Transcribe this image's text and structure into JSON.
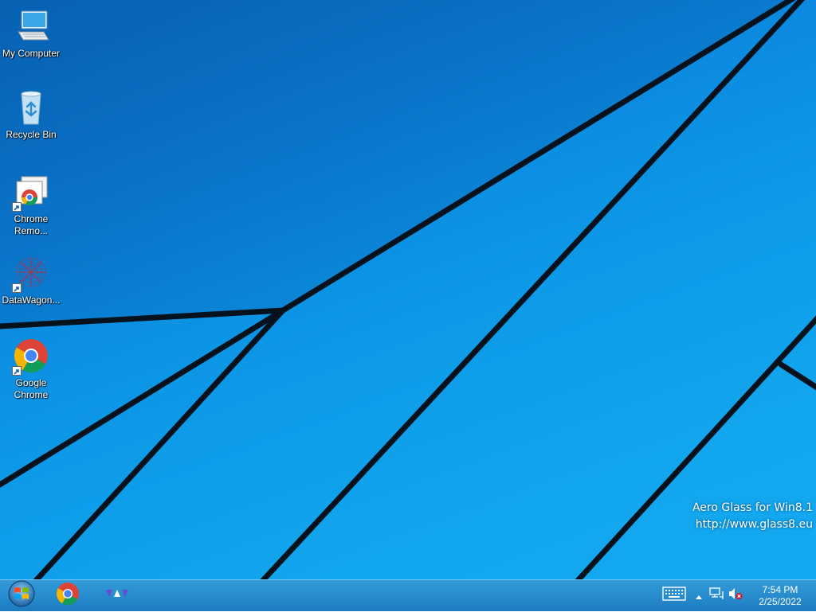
{
  "desktop": {
    "icons": [
      {
        "label": "My Computer",
        "icon": "computer-icon"
      },
      {
        "label": "Recycle Bin",
        "icon": "recycle-bin-icon"
      },
      {
        "label": "Chrome\nRemo...",
        "icon": "chrome-remote-desktop-icon"
      },
      {
        "label": "DataWagon...",
        "icon": "datawagon-icon"
      },
      {
        "label": "Google\nChrome",
        "icon": "google-chrome-icon"
      }
    ],
    "watermark": {
      "line1": "Aero Glass for Win8.1",
      "line2": "http://www.glass8.eu"
    }
  },
  "taskbar": {
    "start_icon": "windows-start-icon",
    "pinned": [
      {
        "name": "Google Chrome",
        "icon": "chrome-icon"
      },
      {
        "name": "DataWagon",
        "icon": "datawagon-icon"
      }
    ],
    "tray": {
      "icons": [
        "keyboard-icon",
        "show-hidden-icons-chevron",
        "network-icon",
        "volume-muted-icon"
      ],
      "time": "7:54 PM",
      "date": "2/25/2022"
    }
  },
  "colors": {
    "wallpaper_dark": "#0a6fc4",
    "wallpaper_light": "#13a9f0",
    "taskbar": "#1f86cc",
    "line": "#03121c"
  }
}
